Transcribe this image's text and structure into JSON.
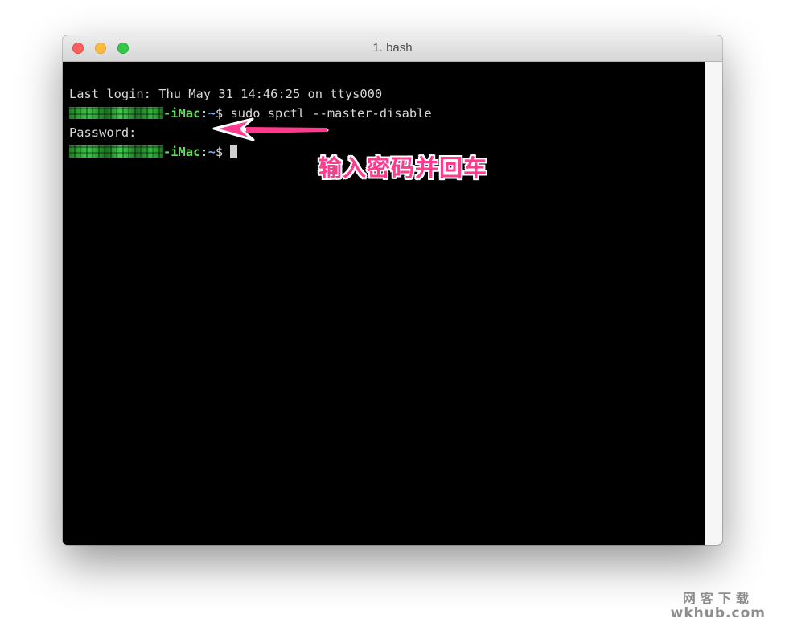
{
  "window": {
    "title": "1. bash"
  },
  "terminal": {
    "line1": "Last login: Thu May 31 14:46:25 on ttys000",
    "host_suffix": "-iMac",
    "colon": ":",
    "path": "~",
    "prompt_symbol": "$",
    "command": " sudo spctl --master-disable",
    "password_prompt": "Password:"
  },
  "annotation": {
    "text": "输入密码并回车",
    "color": "#ff3b8e"
  },
  "watermark": {
    "line1": "网客下载",
    "line2": "wkhub.com"
  },
  "colors": {
    "terminal_bg": "#000000",
    "host": "#5ee05a",
    "path": "#69b6ff",
    "close": "#fc605c",
    "minimize": "#fdbc40",
    "maximize": "#34c84a"
  },
  "icons": [
    "close-icon",
    "minimize-icon",
    "maximize-icon",
    "arrow-annotation-icon"
  ]
}
